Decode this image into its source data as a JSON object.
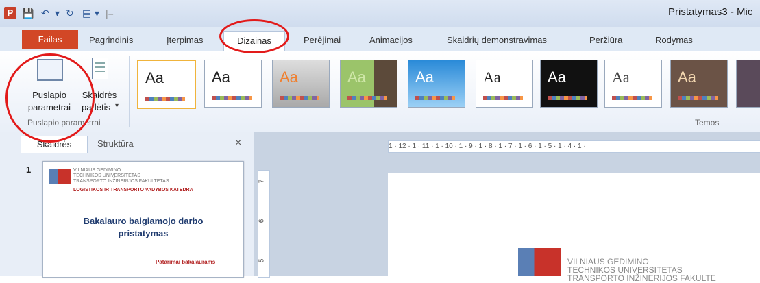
{
  "window": {
    "app_icon": "P",
    "title": "Pristatymas3 - Mic"
  },
  "tabs": [
    "Failas",
    "Pagrindinis",
    "Įterpimas",
    "Dizainas",
    "Perėjimai",
    "Animacijos",
    "Skaidrių demonstravimas",
    "Peržiūra",
    "Rodymas"
  ],
  "ribbon": {
    "page_setup_line1": "Puslapio",
    "page_setup_line2": "parametrai",
    "orientation_line1": "Skaidrės",
    "orientation_line2": "padėtis",
    "group_page_setup": "Puslapio parametrai",
    "group_themes": "Temos",
    "theme_text": "Aa"
  },
  "pane": {
    "tab_slides": "Skaidrės",
    "tab_outline": "Struktūra",
    "close": "×",
    "slide_number": "1"
  },
  "thumbnail": {
    "uni_line1": "VILNIAUS GEDIMINO",
    "uni_line2": "TECHNIKOS UNIVERSITETAS",
    "uni_line3": "TRANSPORTO INŽINERIJOS FAKULTETAS",
    "dept": "LOGISTIKOS IR TRANSPORTO VADYBOS KATEDRA",
    "title_line1": "Bakalauro baigiamojo darbo",
    "title_line2": "pristatymas",
    "footer": "Patarimai bakalaurams"
  },
  "ruler": {
    "horizontal": "1 · 12 · 1 · 11 · 1 · 10 · 1 · 9 · 1 · 8 · 1 · 7 · 1 · 6 · 1 · 5 · 1 · 4 · 1 ·",
    "v1": "7",
    "v2": "6",
    "v3": "5"
  },
  "slide": {
    "uni_line1": "VILNIAUS GEDIMINO",
    "uni_line2": "TECHNIKOS UNIVERSITETAS",
    "uni_line3": "TRANSPORTO INŽINERIJOS FAKULTE"
  },
  "colors": {
    "file_tab": "#d24726",
    "annotation_circle": "#e21a1a"
  }
}
